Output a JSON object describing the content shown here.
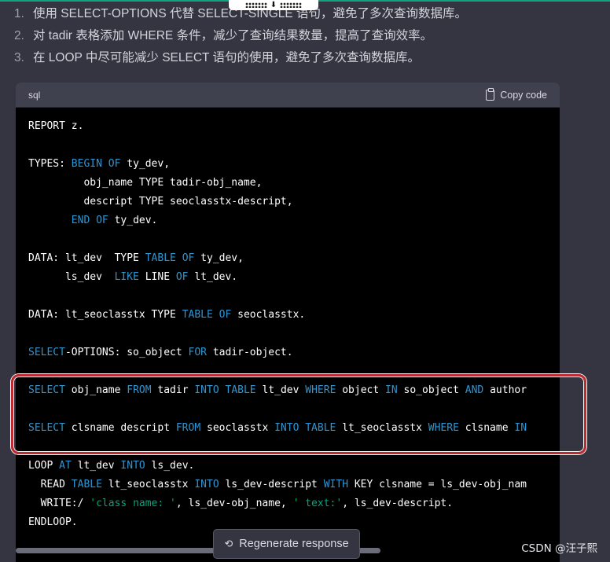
{
  "steps": [
    {
      "num": "1.",
      "text": "使用 SELECT-OPTIONS 代替 SELECT-SINGLE 语句，避免了多次查询数据库。"
    },
    {
      "num": "2.",
      "text": "对 tadir 表格添加 WHERE 条件，减少了查询结果数量，提高了查询效率。"
    },
    {
      "num": "3.",
      "text": "在 LOOP 中尽可能减少 SELECT 语句的使用，避免了多次查询数据库。"
    }
  ],
  "code_block": {
    "language": "sql",
    "copy_label": "Copy code",
    "lines": [
      [
        {
          "t": "REPORT z."
        }
      ],
      [],
      [
        {
          "t": "TYPES: "
        },
        {
          "t": "BEGIN",
          "c": "kw"
        },
        {
          "t": " "
        },
        {
          "t": "OF",
          "c": "kw"
        },
        {
          "t": " ty_dev,"
        }
      ],
      [
        {
          "t": "         obj_name TYPE tadir-obj_name,"
        }
      ],
      [
        {
          "t": "         descript TYPE seoclasstx-descript,"
        }
      ],
      [
        {
          "t": "       "
        },
        {
          "t": "END",
          "c": "kw"
        },
        {
          "t": " "
        },
        {
          "t": "OF",
          "c": "kw"
        },
        {
          "t": " ty_dev."
        }
      ],
      [],
      [
        {
          "t": "DATA: lt_dev  TYPE "
        },
        {
          "t": "TABLE",
          "c": "kw"
        },
        {
          "t": " "
        },
        {
          "t": "OF",
          "c": "kw"
        },
        {
          "t": " ty_dev,"
        }
      ],
      [
        {
          "t": "      ls_dev  "
        },
        {
          "t": "LIKE",
          "c": "kw"
        },
        {
          "t": " LINE "
        },
        {
          "t": "OF",
          "c": "kw"
        },
        {
          "t": " lt_dev."
        }
      ],
      [],
      [
        {
          "t": "DATA: lt_seoclasstx TYPE "
        },
        {
          "t": "TABLE",
          "c": "kw"
        },
        {
          "t": " "
        },
        {
          "t": "OF",
          "c": "kw"
        },
        {
          "t": " seoclasstx."
        }
      ],
      [],
      [
        {
          "t": "SELECT",
          "c": "kw"
        },
        {
          "t": "-OPTIONS: so_object "
        },
        {
          "t": "FOR",
          "c": "kw"
        },
        {
          "t": " tadir-object."
        }
      ],
      [],
      [
        {
          "t": "SELECT",
          "c": "kw"
        },
        {
          "t": " obj_name "
        },
        {
          "t": "FROM",
          "c": "kw"
        },
        {
          "t": " tadir "
        },
        {
          "t": "INTO",
          "c": "kw"
        },
        {
          "t": " "
        },
        {
          "t": "TABLE",
          "c": "kw"
        },
        {
          "t": " lt_dev "
        },
        {
          "t": "WHERE",
          "c": "kw"
        },
        {
          "t": " object "
        },
        {
          "t": "IN",
          "c": "kw"
        },
        {
          "t": " so_object "
        },
        {
          "t": "AND",
          "c": "kw"
        },
        {
          "t": " author"
        }
      ],
      [],
      [
        {
          "t": "SELECT",
          "c": "kw"
        },
        {
          "t": " clsname descript "
        },
        {
          "t": "FROM",
          "c": "kw"
        },
        {
          "t": " seoclasstx "
        },
        {
          "t": "INTO",
          "c": "kw"
        },
        {
          "t": " "
        },
        {
          "t": "TABLE",
          "c": "kw"
        },
        {
          "t": " lt_seoclasstx "
        },
        {
          "t": "WHERE",
          "c": "kw"
        },
        {
          "t": " clsname "
        },
        {
          "t": "IN",
          "c": "kw"
        }
      ],
      [],
      [
        {
          "t": "LOOP "
        },
        {
          "t": "AT",
          "c": "kw"
        },
        {
          "t": " lt_dev "
        },
        {
          "t": "INTO",
          "c": "kw"
        },
        {
          "t": " ls_dev."
        }
      ],
      [
        {
          "t": "  READ "
        },
        {
          "t": "TABLE",
          "c": "kw"
        },
        {
          "t": " lt_seoclasstx "
        },
        {
          "t": "INTO",
          "c": "kw"
        },
        {
          "t": " ls_dev-descript "
        },
        {
          "t": "WITH",
          "c": "kw"
        },
        {
          "t": " KEY clsname = ls_dev-obj_nam"
        }
      ],
      [
        {
          "t": "  WRITE:/ "
        },
        {
          "t": "'class name: '",
          "c": "str"
        },
        {
          "t": ", ls_dev-obj_name, "
        },
        {
          "t": "' text:'",
          "c": "str"
        },
        {
          "t": ", ls_dev-descript."
        }
      ],
      [
        {
          "t": "ENDLOOP."
        }
      ]
    ]
  },
  "regenerate_label": "Regenerate response",
  "watermark": "CSDN @汪子熙",
  "colors": {
    "keyword": "#2e95d3",
    "string": "#00a67d",
    "highlight_border": "#c0292f"
  },
  "icons": {
    "copy": "clipboard-icon",
    "regenerate": "refresh-icon",
    "drag": "grip-icon"
  }
}
